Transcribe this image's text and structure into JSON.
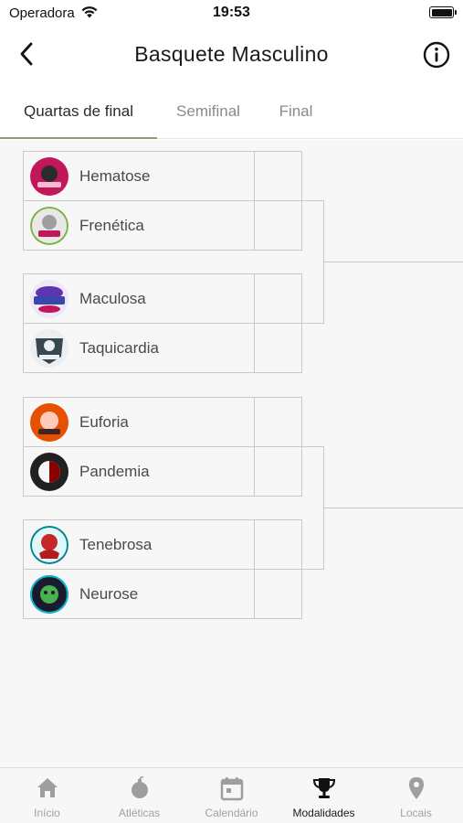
{
  "status_bar": {
    "carrier": "Operadora",
    "time": "19:53"
  },
  "header": {
    "title": "Basquete Masculino",
    "back_icon": "chevron-left-icon",
    "info_icon": "info-circle-icon"
  },
  "tabs": [
    {
      "label": "Quartas de final",
      "active": true
    },
    {
      "label": "Semifinal",
      "active": false
    },
    {
      "label": "Final",
      "active": false
    }
  ],
  "bracket": {
    "matches": [
      {
        "teams": [
          {
            "name": "Hematose",
            "score": "",
            "logo_color": "#c2185b"
          },
          {
            "name": "Frenética",
            "score": "",
            "logo_color": "#7cb342"
          }
        ]
      },
      {
        "teams": [
          {
            "name": "Maculosa",
            "score": "",
            "logo_color": "#5e35b1"
          },
          {
            "name": "Taquicardia",
            "score": "",
            "logo_color": "#37474f"
          }
        ]
      },
      {
        "teams": [
          {
            "name": "Euforia",
            "score": "",
            "logo_color": "#e65100"
          },
          {
            "name": "Pandemia",
            "score": "",
            "logo_color": "#212121"
          }
        ]
      },
      {
        "teams": [
          {
            "name": "Tenebrosa",
            "score": "",
            "logo_color": "#00838f"
          },
          {
            "name": "Neurose",
            "score": "",
            "logo_color": "#1a237e"
          }
        ]
      }
    ]
  },
  "bottom_nav": [
    {
      "label": "Início",
      "icon": "home-icon",
      "active": false
    },
    {
      "label": "Atléticas",
      "icon": "bomb-icon",
      "active": false
    },
    {
      "label": "Calendário",
      "icon": "calendar-icon",
      "active": false
    },
    {
      "label": "Modalidades",
      "icon": "trophy-icon",
      "active": true
    },
    {
      "label": "Locais",
      "icon": "location-pin-icon",
      "active": false
    }
  ]
}
